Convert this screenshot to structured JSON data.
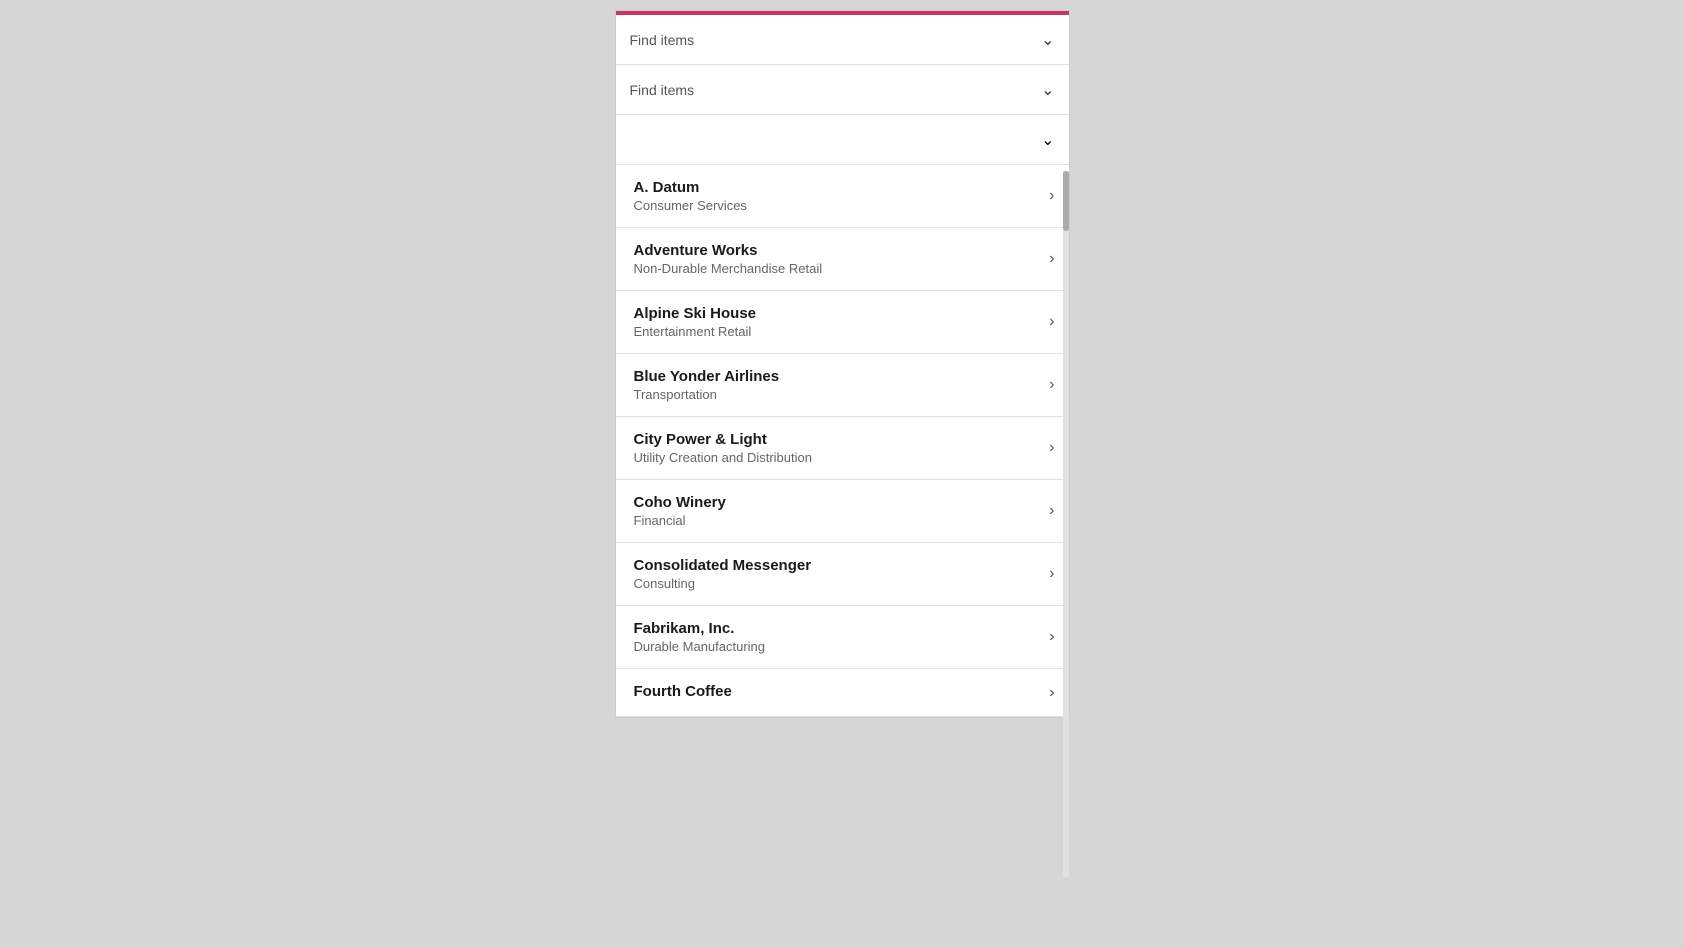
{
  "topBar": {
    "color": "#cc3366"
  },
  "filters": [
    {
      "id": "filter1",
      "placeholder": "Find items",
      "hasValue": false
    },
    {
      "id": "filter2",
      "placeholder": "Find items",
      "hasValue": false
    },
    {
      "id": "filter3",
      "placeholder": "",
      "hasValue": false
    }
  ],
  "chevronSymbol": "⌄",
  "items": [
    {
      "id": "a-datum",
      "name": "A. Datum",
      "subtitle": "Consumer Services"
    },
    {
      "id": "adventure-works",
      "name": "Adventure Works",
      "subtitle": "Non-Durable Merchandise Retail"
    },
    {
      "id": "alpine-ski-house",
      "name": "Alpine Ski House",
      "subtitle": "Entertainment Retail"
    },
    {
      "id": "blue-yonder-airlines",
      "name": "Blue Yonder Airlines",
      "subtitle": "Transportation"
    },
    {
      "id": "city-power-light",
      "name": "City Power & Light",
      "subtitle": "Utility Creation and Distribution"
    },
    {
      "id": "coho-winery",
      "name": "Coho Winery",
      "subtitle": "Financial"
    },
    {
      "id": "consolidated-messenger",
      "name": "Consolidated Messenger",
      "subtitle": "Consulting"
    },
    {
      "id": "fabrikam-inc",
      "name": "Fabrikam, Inc.",
      "subtitle": "Durable Manufacturing"
    },
    {
      "id": "fourth-coffee",
      "name": "Fourth Coffee",
      "subtitle": ""
    }
  ],
  "arrowRight": "›"
}
